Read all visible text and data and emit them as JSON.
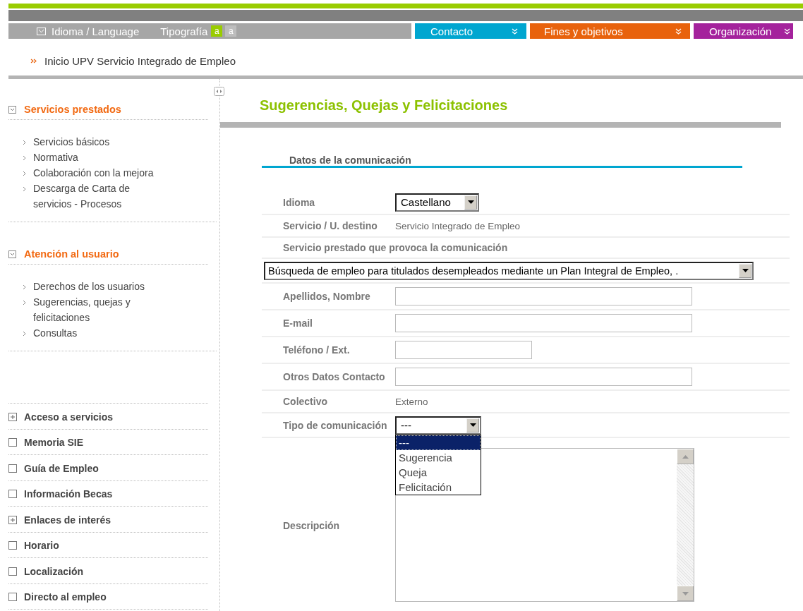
{
  "top_nav": {
    "language": "Idioma / Language",
    "typography": {
      "label": "Tipografía",
      "sizes": [
        {
          "label": "a",
          "selected": true
        },
        {
          "label": "a",
          "selected": false
        }
      ]
    },
    "menus": [
      {
        "label": "Contacto",
        "color": "#00a6d0"
      },
      {
        "label": "Fines y objetivos",
        "color": "#e8620c"
      },
      {
        "label": "Organización",
        "color": "#a4229c"
      }
    ]
  },
  "breadcrumb": "Inicio UPV Servicio Integrado de Empleo",
  "sidebar": {
    "sections": [
      {
        "title": "Servicios prestados",
        "expanded": true,
        "items": [
          "Servicios básicos",
          "Normativa",
          "Colaboración con la mejora",
          "Descarga de Carta de servicios - Procesos"
        ]
      },
      {
        "title": "Atención al usuario",
        "expanded": true,
        "items": [
          "Derechos de los usuarios",
          "Sugerencias, quejas y felicitaciones",
          "Consultas"
        ]
      }
    ],
    "links": [
      {
        "label": "Acceso  a servicios",
        "expandable": true
      },
      {
        "label": "Memoria  SIE",
        "expandable": false
      },
      {
        "label": "Guía de Empleo",
        "expandable": false
      },
      {
        "label": "Información Becas",
        "expandable": false
      },
      {
        "label": "Enlaces de interés",
        "expandable": true
      },
      {
        "label": "Horario",
        "expandable": false
      },
      {
        "label": "Localización",
        "expandable": false
      },
      {
        "label": "Directo al empleo",
        "expandable": false
      }
    ]
  },
  "page_title": "Sugerencias, Quejas y Felicitaciones",
  "form": {
    "section": "Datos de la comunicación",
    "rows": [
      {
        "kind": "select",
        "label": "Idioma",
        "value": "Castellano"
      },
      {
        "kind": "static",
        "label": "Servicio / U. destino",
        "value": "Servicio Integrado de Empleo"
      },
      {
        "kind": "heading",
        "label": "Servicio prestado que provoca la comunicación"
      },
      {
        "kind": "wide-select",
        "value": "Búsqueda de empleo para titulados desempleados mediante un Plan Integral de Empleo, ."
      },
      {
        "kind": "input",
        "label": "Apellidos, Nombre"
      },
      {
        "kind": "input",
        "label": "E-mail"
      },
      {
        "kind": "short-input",
        "label": "Teléfono / Ext."
      },
      {
        "kind": "input",
        "label": "Otros  Datos Contacto"
      },
      {
        "kind": "static",
        "label": "Colectivo",
        "value": "Externo"
      },
      {
        "kind": "open-select",
        "label": "Tipo de comunicación",
        "value": "---",
        "options": [
          {
            "label": "---",
            "selected": true
          },
          {
            "label": "Sugerencia",
            "selected": false
          },
          {
            "label": "Queja",
            "selected": false
          },
          {
            "label": "Felicitación",
            "selected": false
          }
        ]
      },
      {
        "kind": "textarea",
        "label": "Descripción"
      }
    ]
  }
}
